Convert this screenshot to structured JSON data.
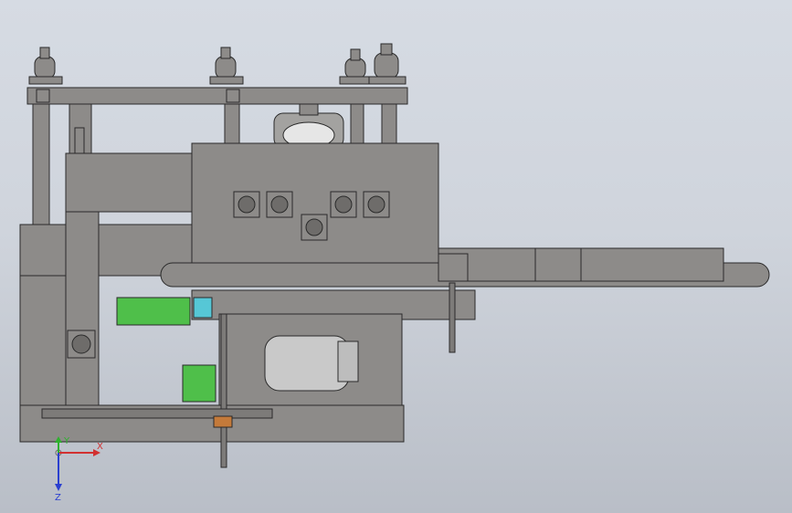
{
  "viewport": {
    "background_top": "#d6dbe3",
    "background_bottom": "#b9bec7"
  },
  "model": {
    "frame_color": "#8d8b89",
    "edge_color": "#2a2a2a",
    "panel_color": "#8f8d8b",
    "green_part_color": "#4fbf4a",
    "motor_color": "#c9c9c9",
    "cyan_part_color": "#56c7d6"
  },
  "triad": {
    "x_label": "X",
    "y_label": "Y",
    "z_label": "Z",
    "x_color": "#d23030",
    "y_color": "#2fb12f",
    "z_color": "#2a3fd0"
  }
}
